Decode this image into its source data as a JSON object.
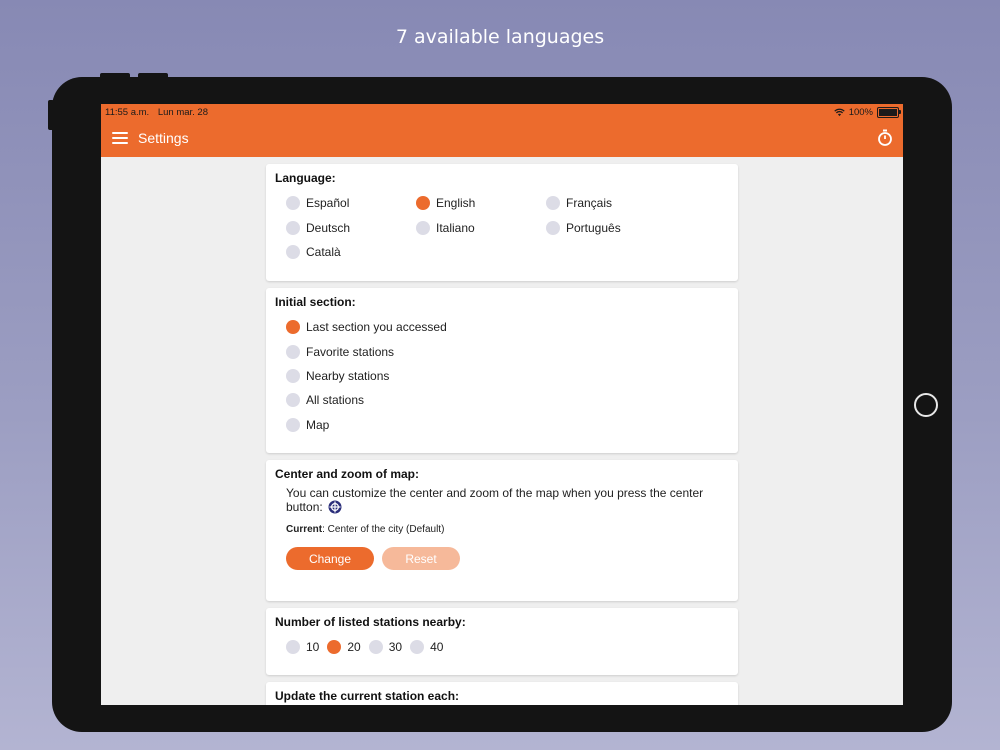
{
  "headline": "7 available languages",
  "status_bar": {
    "time": "11:55 a.m.",
    "date": "Lun mar. 28",
    "battery": "100%",
    "battery_level": 1.0
  },
  "app_bar": {
    "title": "Settings",
    "menu_icon": "hamburger-menu-icon",
    "action_icon": "stopwatch-icon"
  },
  "colors": {
    "accent": "#ec6b2d",
    "radio_off": "#dcdce6",
    "reset_button": "#f6b99a",
    "target_icon": "#2a2e7a"
  },
  "language_card": {
    "title": "Language:",
    "options": [
      {
        "label": "Español",
        "selected": false
      },
      {
        "label": "English",
        "selected": true
      },
      {
        "label": "Français",
        "selected": false
      },
      {
        "label": "Deutsch",
        "selected": false
      },
      {
        "label": "Italiano",
        "selected": false
      },
      {
        "label": "Português",
        "selected": false
      },
      {
        "label": "Català",
        "selected": false
      }
    ]
  },
  "initial_section_card": {
    "title": "Initial section:",
    "options": [
      {
        "label": "Last section you accessed",
        "selected": true
      },
      {
        "label": "Favorite stations",
        "selected": false
      },
      {
        "label": "Nearby stations",
        "selected": false
      },
      {
        "label": "All stations",
        "selected": false
      },
      {
        "label": "Map",
        "selected": false
      }
    ]
  },
  "map_card": {
    "title": "Center and zoom of map:",
    "description": "You can customize the center and zoom of the map when you press the center button:",
    "center_icon": "crosshair-target-icon",
    "current_label": "Current",
    "current_value": ": Center of the city (Default)",
    "change_label": "Change",
    "reset_label": "Reset"
  },
  "nearby_card": {
    "title": "Number of listed stations nearby:",
    "options": [
      {
        "label": "10",
        "selected": false
      },
      {
        "label": "20",
        "selected": true
      },
      {
        "label": "30",
        "selected": false
      },
      {
        "label": "40",
        "selected": false
      }
    ]
  },
  "update_card": {
    "title": "Update the current station each:"
  }
}
